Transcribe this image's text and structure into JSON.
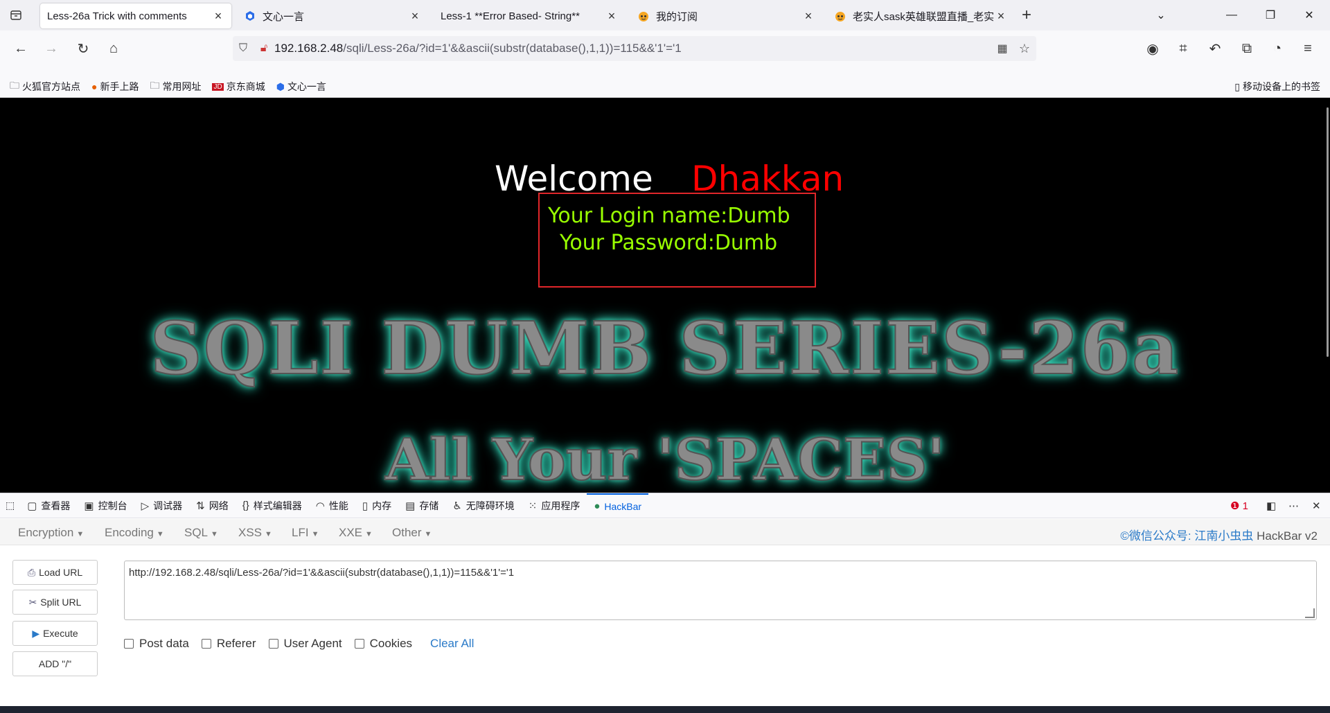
{
  "tabs": [
    {
      "title": "Less-26a Trick with comments",
      "active": true,
      "icon": "none"
    },
    {
      "title": "文心一言",
      "active": false,
      "icon": "wenxin-icon"
    },
    {
      "title": "Less-1 **Error Based- String**",
      "active": false,
      "icon": "none"
    },
    {
      "title": "我的订阅",
      "active": false,
      "icon": "bilibili-icon"
    },
    {
      "title": "老实人sask英雄联盟直播_老实",
      "active": false,
      "icon": "bilibili-icon"
    }
  ],
  "url": {
    "host": "192.168.2.48",
    "path": "/sqli/Less-26a/?id=1'&&ascii(substr(database(),1,1))=115&&'1'='1"
  },
  "bookmarks": [
    "火狐官方站点",
    "新手上路",
    "常用网址",
    "京东商城",
    "文心一言"
  ],
  "mobile_bookmarks": "移动设备上的书签",
  "page": {
    "welcome": "Welcome",
    "name": "Dhakkan",
    "login_line": "Your Login name:Dumb",
    "password_line": "Your Password:Dumb",
    "banner1": "SQLI DUMB SERIES-26a",
    "banner2": "All Your 'SPACES'"
  },
  "devtools": {
    "tabs": [
      "查看器",
      "控制台",
      "调试器",
      "网络",
      "样式编辑器",
      "性能",
      "内存",
      "存储",
      "无障碍环境",
      "应用程序",
      "HackBar"
    ],
    "error_count": "1"
  },
  "hackbar": {
    "menu": [
      "Encryption",
      "Encoding",
      "SQL",
      "XSS",
      "LFI",
      "XXE",
      "Other"
    ],
    "brand": "©微信公众号: 江南小虫虫",
    "version": "HackBar v2",
    "buttons": [
      "Load URL",
      "Split URL",
      "Execute",
      "ADD \"/\""
    ],
    "url_value": "http://192.168.2.48/sqli/Less-26a/?id=1'&&ascii(substr(database(),1,1))=115&&'1'='1",
    "options": [
      "Post data",
      "Referer",
      "User Agent",
      "Cookies"
    ],
    "clear_all": "Clear All"
  },
  "colors": {
    "welcome": "#ffffff",
    "name": "#ff0000",
    "login": "#99ff00",
    "box_border": "#e0262a",
    "hackbar_link": "#2a7ac8"
  }
}
